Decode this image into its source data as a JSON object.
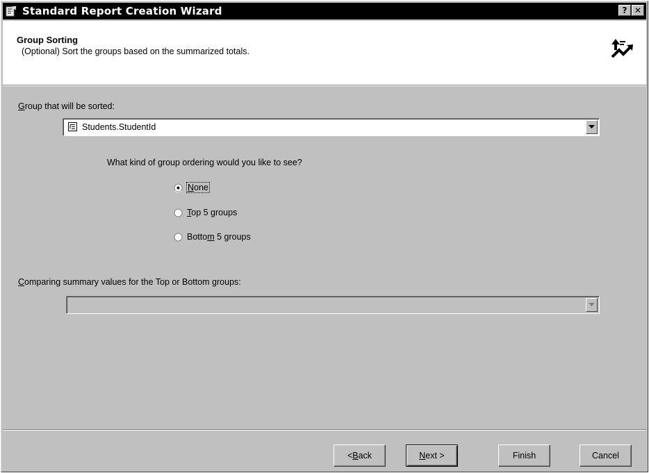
{
  "window": {
    "title": "Standard Report Creation Wizard",
    "help_glyph": "?",
    "close_glyph": "✕",
    "app_icon": "report-wizard-icon"
  },
  "header": {
    "step_title": "Group Sorting",
    "step_description": "(Optional) Sort the groups based on the summarized totals.",
    "icon": "sort-arrows-icon"
  },
  "group_select": {
    "label_mnemonic": "G",
    "label_rest": "roup that will be sorted:",
    "value": "Students.StudentId",
    "icon": "field-list-icon"
  },
  "ordering": {
    "question": "What kind of group ordering would you like to see?",
    "options": [
      {
        "pre": "",
        "mnemonic": "N",
        "post": "one",
        "selected": true
      },
      {
        "pre": "",
        "mnemonic": "T",
        "post": "op 5 groups",
        "selected": false
      },
      {
        "pre": "Botto",
        "mnemonic": "m",
        "post": " 5 groups",
        "selected": false
      }
    ]
  },
  "summary_select": {
    "label_mnemonic": "C",
    "label_rest": "omparing summary values for the Top or Bottom groups:",
    "value": "",
    "enabled": false
  },
  "buttons": {
    "back_pre": "< ",
    "back_mnemonic": "B",
    "back_post": "ack",
    "next_mnemonic": "N",
    "next_post": "ext >",
    "finish": "Finish",
    "cancel": "Cancel"
  },
  "colors": {
    "face": "#c0c0c0",
    "titlebar": "#000000",
    "header_bg": "#ffffff"
  }
}
